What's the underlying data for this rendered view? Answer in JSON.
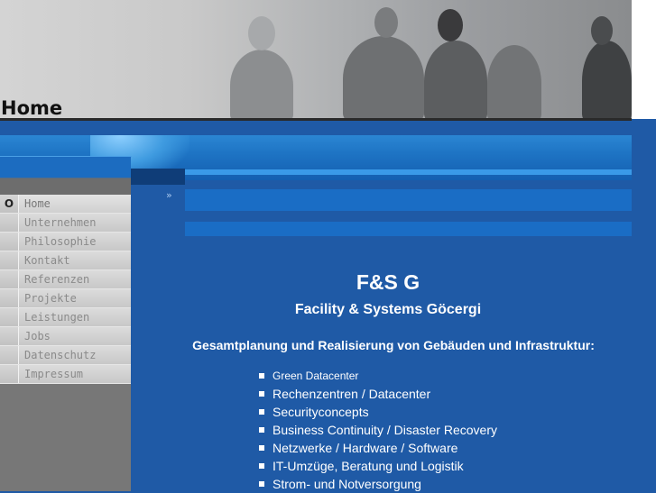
{
  "header": {
    "title": "Home"
  },
  "nav": {
    "active_marker": "O",
    "items": [
      {
        "label": "Home",
        "active": true
      },
      {
        "label": "Unternehmen"
      },
      {
        "label": "Philosophie"
      },
      {
        "label": "Kontakt"
      },
      {
        "label": "Referenzen"
      },
      {
        "label": "Projekte"
      },
      {
        "label": "Leistungen"
      },
      {
        "label": "Jobs"
      },
      {
        "label": "Datenschutz"
      },
      {
        "label": "Impressum"
      }
    ]
  },
  "band": {
    "chevron": "»"
  },
  "main": {
    "company": "F&S G",
    "subtitle": "Facility & Systems Göcergi",
    "intro": "Gesamtplanung und Realisierung von Gebäuden und Infrastruktur:",
    "services": [
      "Green Datacenter",
      "Rechenzentren / Datacenter",
      "Securityconcepts",
      "Business Continuity / Disaster Recovery",
      "Netzwerke / Hardware / Software",
      "IT-Umzüge, Beratung und Logistik",
      "Strom- und Notversorgung"
    ]
  },
  "colors": {
    "background": "#1f5aa6",
    "nav_bg": "#777777",
    "text": "#ffffff"
  }
}
